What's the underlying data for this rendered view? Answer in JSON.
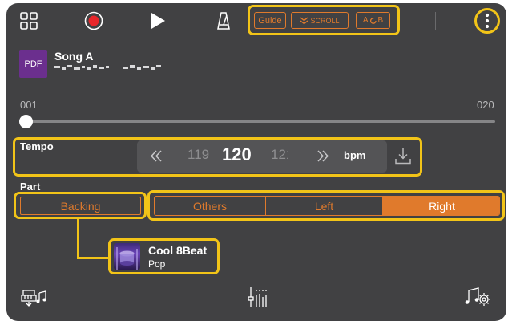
{
  "toolbar": {
    "items": [
      "grid-icon",
      "record-icon",
      "play-icon",
      "metronome-icon",
      "more-icon"
    ],
    "guide_label": "Guide",
    "scroll_label": "SCROLL",
    "ab_label": "A B"
  },
  "song": {
    "file_badge": "PDF",
    "title": "Song A",
    "subtitle_obscured": true
  },
  "position": {
    "start_label": "001",
    "end_label": "020",
    "current_fraction": 0.0
  },
  "tempo": {
    "label": "Tempo",
    "prev_value": "119",
    "current_value": "120",
    "next_value": "121",
    "unit": "bpm"
  },
  "part": {
    "label": "Part",
    "backing_label": "Backing",
    "segments": [
      "Others",
      "Left",
      "Right"
    ],
    "selected_segment": "Right"
  },
  "style": {
    "name": "Cool 8Beat",
    "genre": "Pop"
  },
  "colors": {
    "background": "#414143",
    "accent_orange": "#e07a2c",
    "highlight_yellow": "#f2c418",
    "record_red": "#e8262a",
    "pdf_purple": "#6b2f8e",
    "tempo_panel": "#545456"
  },
  "bottom_bar": {
    "items": [
      "style-setup-icon",
      "mixer-icon",
      "song-settings-icon"
    ]
  }
}
